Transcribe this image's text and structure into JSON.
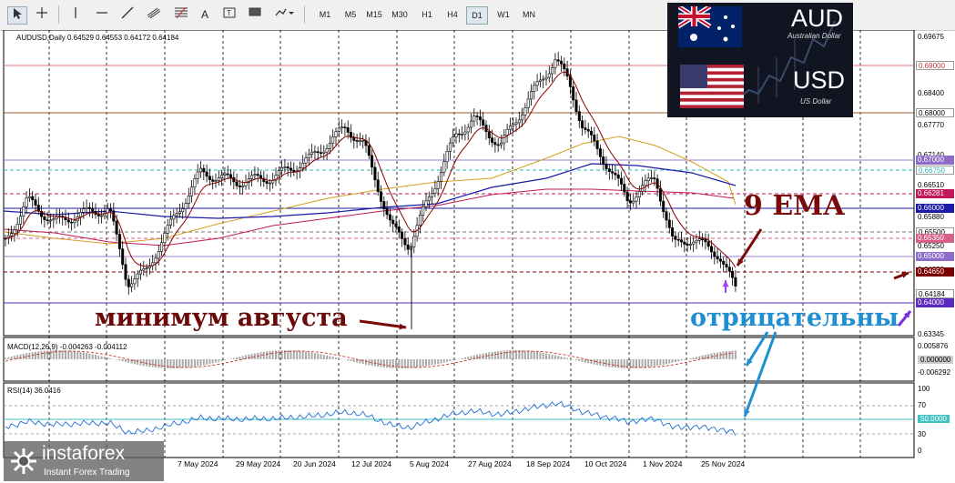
{
  "toolbar": {
    "timeframes": [
      "M1",
      "M5",
      "M15",
      "M30",
      "H1",
      "H4",
      "D1",
      "W1",
      "MN"
    ],
    "active_timeframe": "D1",
    "text_tool": "A"
  },
  "chart": {
    "symbol_info": "AUDUSD,Daily  0.64529 0.64553 0.64172 0.64184",
    "price_axis": [
      "0.69675",
      "0.68400",
      "0.67770",
      "0.67140",
      "0.66510",
      "0.65880",
      "0.65250",
      "0.64620",
      "0.63345"
    ],
    "level_labels": [
      {
        "text": "0.69000",
        "color": "#c0392b",
        "bg": "#fff"
      },
      {
        "text": "0.68000",
        "color": "#000",
        "bg": "#fff"
      },
      {
        "text": "0.67000",
        "color": "#fff",
        "bg": "#8e6cc9"
      },
      {
        "text": "0.66750",
        "color": "#2ab7b7",
        "bg": "#fff"
      },
      {
        "text": "0.66281",
        "color": "#fff",
        "bg": "#c2185b"
      },
      {
        "text": "0.66000",
        "color": "#fff",
        "bg": "#1a1aa6"
      },
      {
        "text": "0.65500",
        "color": "#000",
        "bg": "#fff"
      },
      {
        "text": "0.65350",
        "color": "#fff",
        "bg": "#d65f8a"
      },
      {
        "text": "0.65000",
        "color": "#fff",
        "bg": "#8e6cc9"
      },
      {
        "text": "0.64650",
        "color": "#fff",
        "bg": "#7a0000"
      },
      {
        "text": "0.64184",
        "color": "#000",
        "bg": "#fff"
      },
      {
        "text": "0.64000",
        "color": "#fff",
        "bg": "#5b2bbf"
      }
    ],
    "dates": [
      "7 May 2024",
      "29 May 2024",
      "20 Jun 2024",
      "12 Jul 2024",
      "5 Aug 2024",
      "27 Aug 2024",
      "18 Sep 2024",
      "10 Oct 2024",
      "1 Nov 2024",
      "25 Nov 2024"
    ],
    "annotations": {
      "ema": "9 EMA",
      "august_low": "минимум августа",
      "negative": "отрицательны"
    },
    "logo": {
      "base": "AUD",
      "base_sub": "Australian Dollar",
      "quote": "USD",
      "quote_sub": "US Dollar"
    }
  },
  "macd": {
    "label": "MACD(12,26,9) -0.004263 -0.004112",
    "axis": [
      "0.005876",
      "0.000000",
      "-0.006292"
    ]
  },
  "rsi": {
    "label": "RSI(14) 36.0416",
    "axis": [
      "100",
      "70",
      "50.0000",
      "30",
      "0"
    ]
  },
  "watermark": {
    "brand": "instaforex",
    "tagline": "Instant Forex Trading"
  }
}
